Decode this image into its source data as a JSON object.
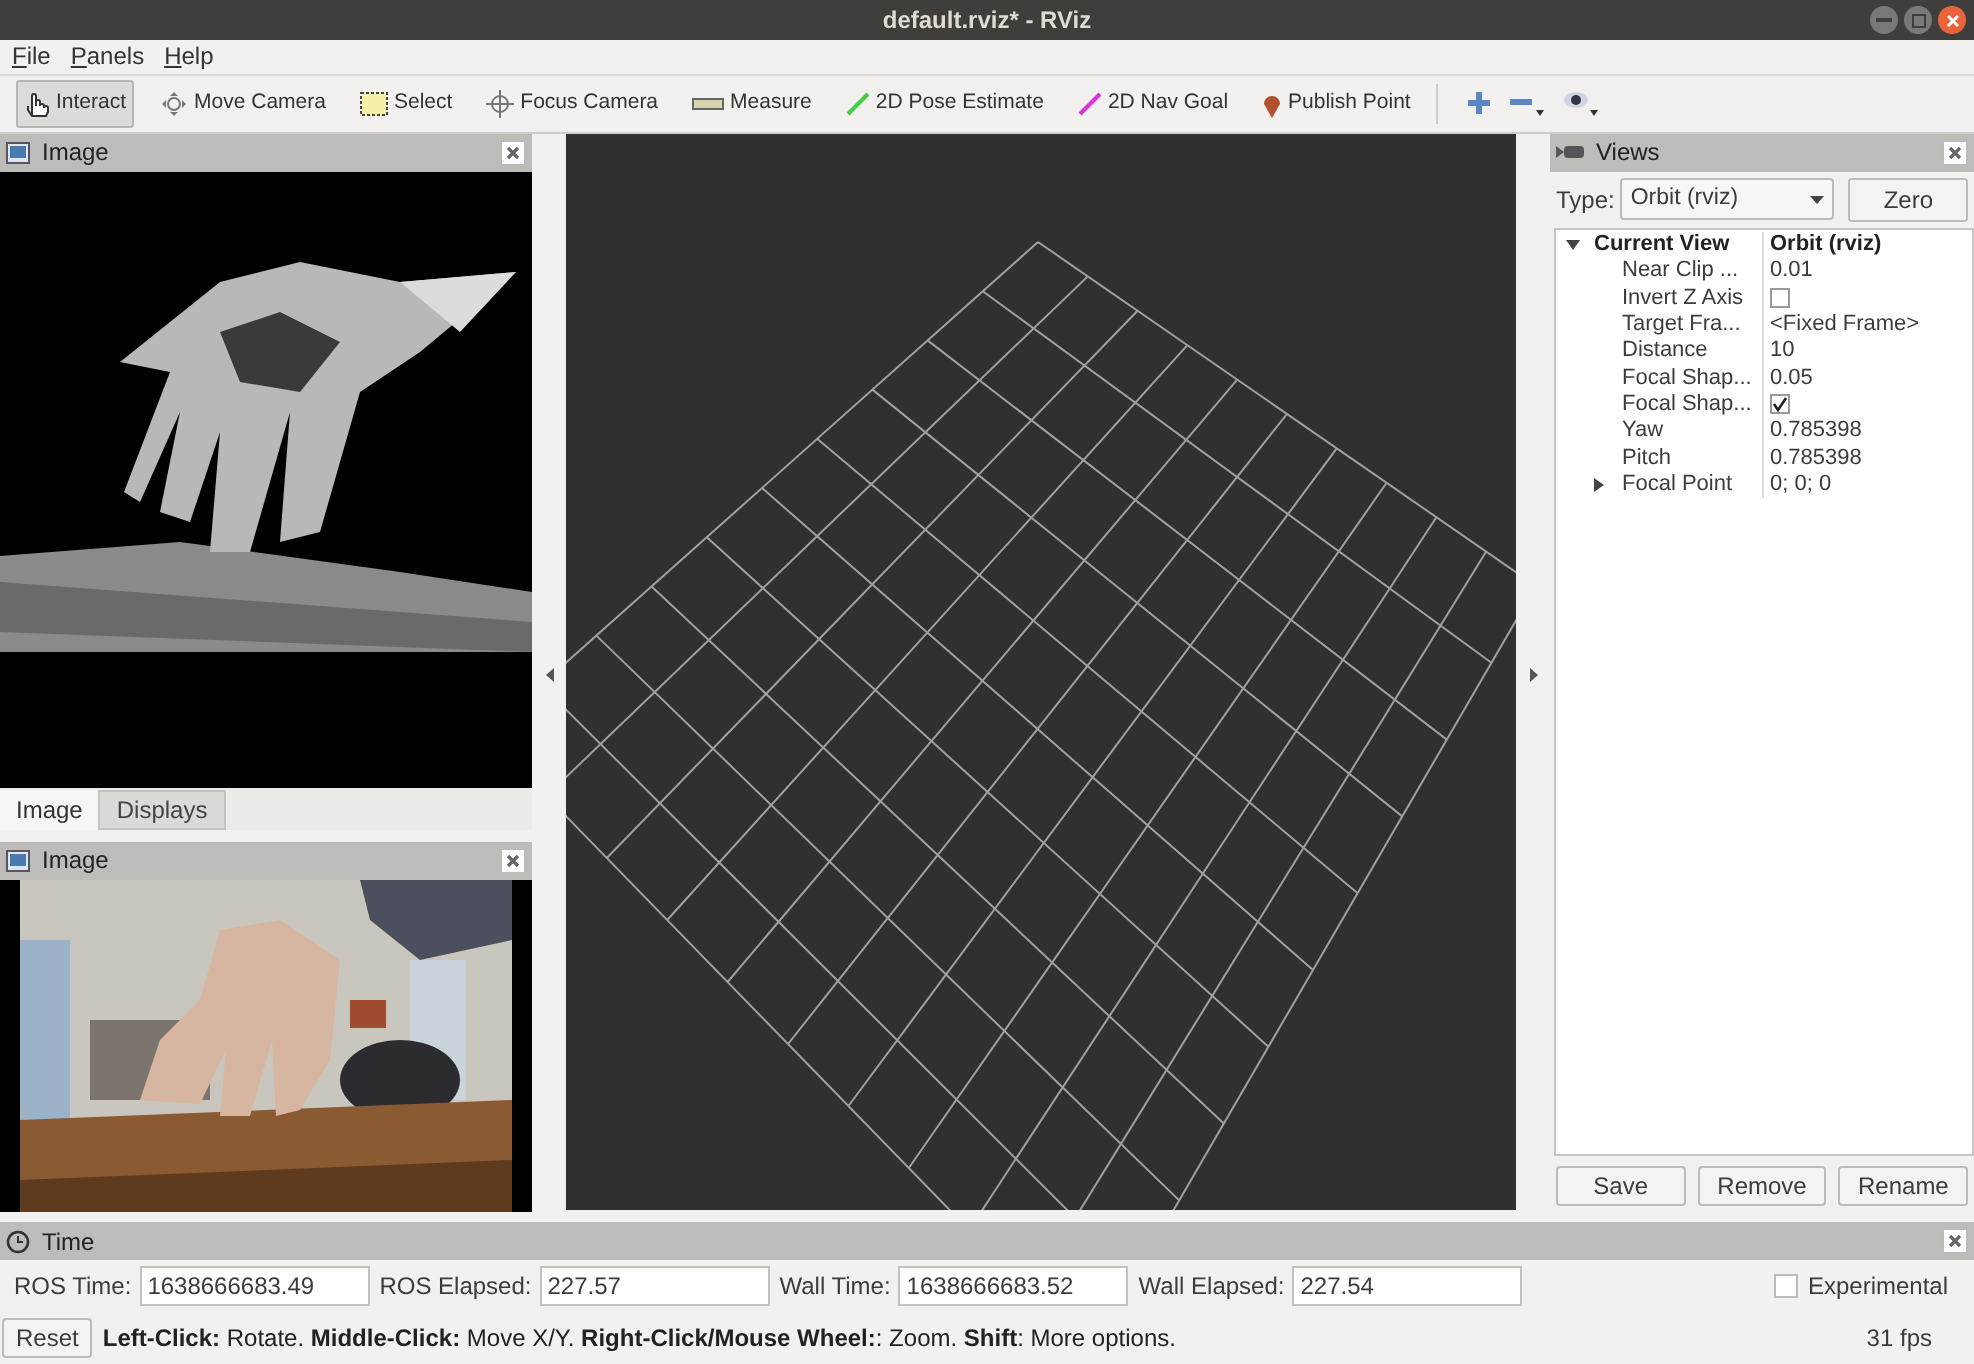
{
  "window": {
    "title": "default.rviz* - RViz"
  },
  "menu": [
    "File",
    "Panels",
    "Help"
  ],
  "toolbar": [
    {
      "label": "Interact",
      "selected": true
    },
    {
      "label": "Move Camera",
      "selected": false
    },
    {
      "label": "Select",
      "selected": false
    },
    {
      "label": "Focus Camera",
      "selected": false
    },
    {
      "label": "Measure",
      "selected": false
    },
    {
      "label": "2D Pose Estimate",
      "selected": false
    },
    {
      "label": "2D Nav Goal",
      "selected": false
    },
    {
      "label": "Publish Point",
      "selected": false
    }
  ],
  "left_top_panel": {
    "title": "Image"
  },
  "left_tabs": [
    {
      "label": "Image",
      "selected": true
    },
    {
      "label": "Displays",
      "selected": false
    }
  ],
  "left_bottom_panel": {
    "title": "Image"
  },
  "views": {
    "title": "Views",
    "type_label": "Type:",
    "type_value": "Orbit (rviz)",
    "zero_button": "Zero",
    "properties": [
      {
        "name": "Current View",
        "value": "Orbit (rviz)",
        "expanded": true,
        "children": [
          {
            "kind": "text",
            "name": "Near Clip ...",
            "value": "0.01"
          },
          {
            "kind": "checkbox",
            "name": "Invert Z Axis",
            "checked": false
          },
          {
            "kind": "text",
            "name": "Target Fra...",
            "value": "<Fixed Frame>"
          },
          {
            "kind": "text",
            "name": "Distance",
            "value": "10"
          },
          {
            "kind": "text",
            "name": "Focal Shap...",
            "value": "0.05"
          },
          {
            "kind": "checkbox",
            "name": "Focal Shap...",
            "checked": true
          },
          {
            "kind": "text",
            "name": "Yaw",
            "value": "0.785398"
          },
          {
            "kind": "text",
            "name": "Pitch",
            "value": "0.785398"
          },
          {
            "kind": "text",
            "name": "Focal Point",
            "value": "0; 0; 0",
            "expanded": false
          }
        ]
      }
    ],
    "buttons": [
      "Save",
      "Remove",
      "Rename"
    ]
  },
  "time": {
    "title": "Time",
    "fields": [
      {
        "label": "ROS Time:",
        "value": "1638666683.49"
      },
      {
        "label": "ROS Elapsed:",
        "value": "227.57"
      },
      {
        "label": "Wall Time:",
        "value": "1638666683.52"
      },
      {
        "label": "Wall Elapsed:",
        "value": "227.54"
      }
    ],
    "experimental": {
      "label": "Experimental",
      "checked": false
    }
  },
  "status_bar": {
    "reset_button": "Reset",
    "hint": "**Left-Click:** Rotate. **Middle-Click:** Move X/Y. **Right-Click/Mouse Wheel:**: Zoom. **Shift**: More options.",
    "fps": "31 fps"
  }
}
